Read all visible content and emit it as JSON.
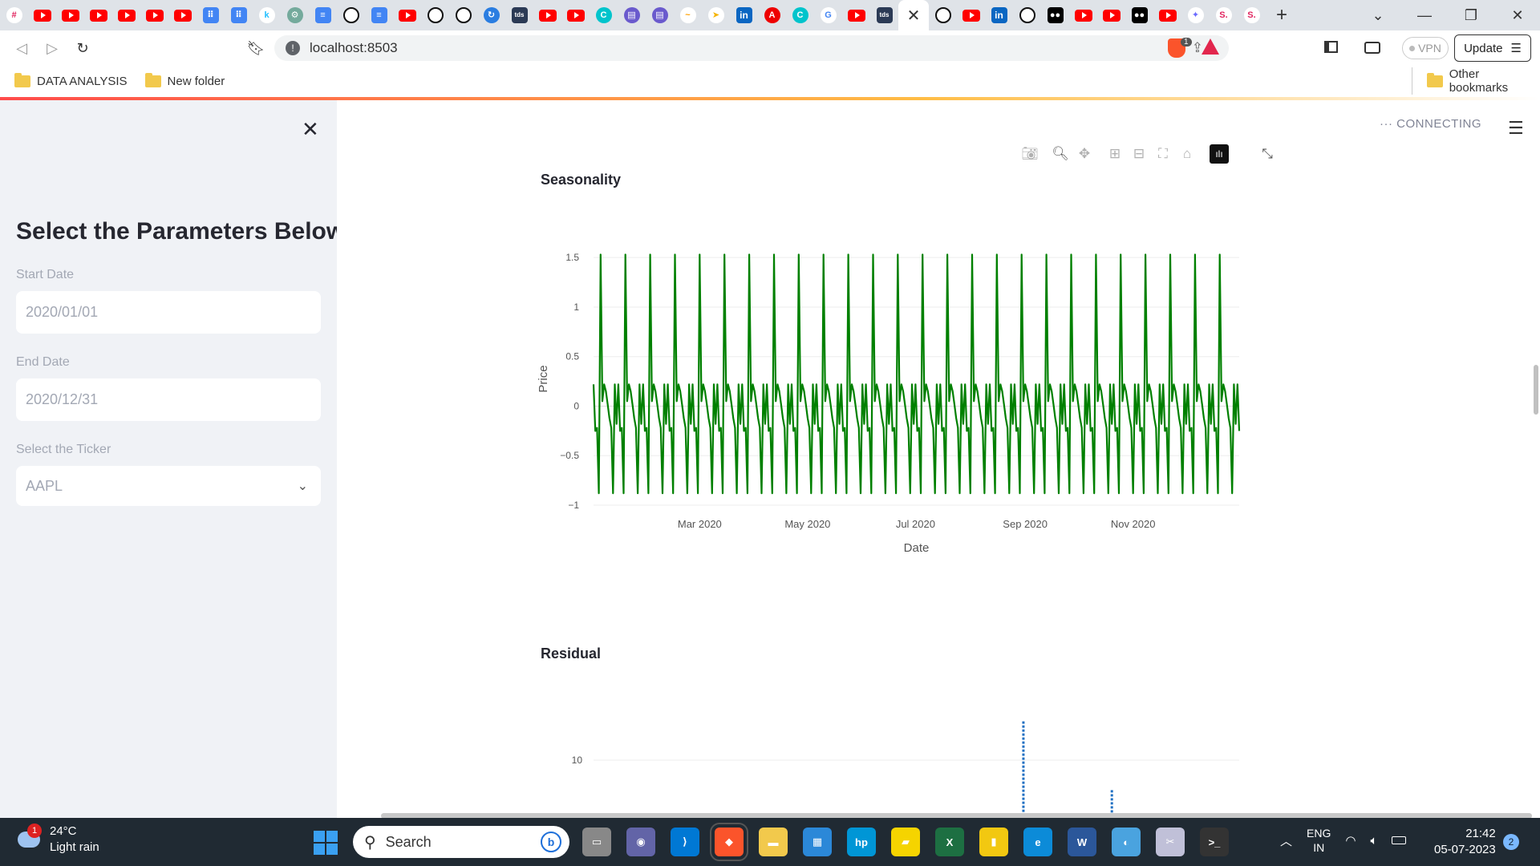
{
  "browser": {
    "url": "localhost:8503",
    "vpn_label": "VPN",
    "update_label": "Update",
    "shields_badge": "1",
    "tabs": [
      "slack",
      "youtube",
      "youtube",
      "youtube",
      "youtube",
      "youtube",
      "youtube",
      "doc",
      "doc",
      "kaggle",
      "chatgpt",
      "docs",
      "github",
      "docs",
      "youtube",
      "github",
      "github",
      "refresh",
      "tds",
      "youtube",
      "youtube",
      "canva",
      "print",
      "print",
      "shine",
      "arrow",
      "linkedin",
      "adobe",
      "canva",
      "google",
      "youtube",
      "tds",
      "active",
      "github",
      "youtube",
      "linkedin",
      "github",
      "medium",
      "youtube",
      "youtube",
      "medium",
      "youtube",
      "gemini",
      "streamlit",
      "streamlit"
    ]
  },
  "bookmarks": {
    "items": [
      "DATA ANALYSIS",
      "New folder"
    ],
    "other": "Other bookmarks"
  },
  "sidebar": {
    "title": "Select the Parameters Below",
    "start_label": "Start Date",
    "start_value": "2020/01/01",
    "end_label": "End Date",
    "end_value": "2020/12/31",
    "ticker_label": "Select the Ticker",
    "ticker_value": "AAPL"
  },
  "app": {
    "status": "CONNECTING",
    "chart1_title": "Seasonality",
    "chart2_title": "Residual"
  },
  "colors": {
    "seasonality_line": "#008000",
    "residual_line": "#1f6fc2",
    "sidebar_bg": "#f0f2f6"
  },
  "chart_data": [
    {
      "type": "line",
      "title": "Seasonality",
      "xlabel": "Date",
      "ylabel": "Price",
      "x_range": [
        "2020-01-01",
        "2020-12-31"
      ],
      "x_ticks": [
        "Mar 2020",
        "May 2020",
        "Jul 2020",
        "Sep 2020",
        "Nov 2020"
      ],
      "y_ticks": [
        -1,
        -0.5,
        0,
        0.5,
        1,
        1.5
      ],
      "ylim": [
        -1,
        1.55
      ],
      "period_days": 14,
      "pattern": [
        0.22,
        -0.25,
        -0.22,
        -0.88,
        1.53,
        0.05,
        0.22,
        0.15,
        0.02,
        -0.12,
        -0.22,
        -0.88,
        0.22,
        -0.18
      ],
      "series": [
        {
          "values": "pattern repeated every 14 days from 2020-01-01 to 2020-12-31",
          "color": "#008000"
        }
      ],
      "grid": true
    },
    {
      "type": "line",
      "title": "Residual",
      "y_ticks": [
        10
      ],
      "series": [
        {
          "color": "#1f6fc2",
          "values": [
            {
              "x": "2020-08-31",
              "y": 12.2
            },
            {
              "x": "2020-10-20",
              "y": 8.3
            }
          ]
        }
      ]
    }
  ],
  "taskbar": {
    "temp": "24°C",
    "weather": "Light rain",
    "weather_badge": "1",
    "search_placeholder": "Search",
    "lang1": "ENG",
    "lang2": "IN",
    "time": "21:42",
    "date": "05-07-2023",
    "notif": "2"
  }
}
